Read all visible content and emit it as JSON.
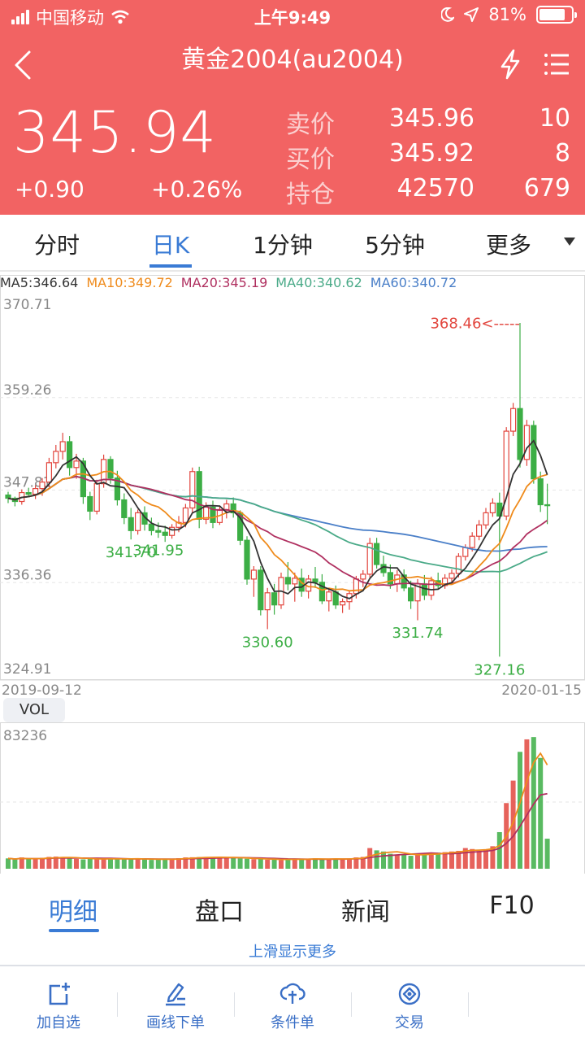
{
  "status_bar": {
    "carrier": "中国移动",
    "time": "上午9:49",
    "battery": "81%",
    "battery_level": 0.81
  },
  "nav": {
    "title": "黄金2004(au2004)",
    "icons": [
      "back-icon",
      "flash-icon",
      "menu-icon"
    ]
  },
  "quote": {
    "last_price": "345.94",
    "change": "+0.90",
    "change_pct": "+0.26%",
    "ask": {
      "label": "卖价",
      "price": "345.96",
      "size": "10"
    },
    "bid": {
      "label": "买价",
      "price": "345.92",
      "size": "8"
    },
    "open_interest": {
      "label": "持仓",
      "value": "42570",
      "change": "679"
    }
  },
  "period_tabs": {
    "items": [
      "分时",
      "日K",
      "1分钟",
      "5分钟",
      "更多"
    ],
    "active": "日K"
  },
  "ma_legend": {
    "ma5": "MA5:346.64",
    "ma10": "MA10:349.72",
    "ma20": "MA20:345.19",
    "ma40": "MA40:340.62",
    "ma60": "MA60:340.72"
  },
  "colors": {
    "up": "#e2463e",
    "down": "#3cae45",
    "accent": "#3a7bd5",
    "header": "#f26363",
    "ma5": "#333333",
    "ma10": "#ef8b1c",
    "ma20": "#b03060",
    "ma40": "#4aaa88",
    "ma60": "#4a7fc8"
  },
  "chart_data": [
    {
      "type": "candlestick",
      "x_start": "2019-09-12",
      "x_end": "2020-01-15",
      "y_ticks": [
        "370.71",
        "359.26",
        "347.81",
        "336.36",
        "324.91"
      ],
      "ylim": [
        324.91,
        370.71
      ],
      "annotations": [
        {
          "label": "368.46<-----",
          "value": 368.46
        },
        {
          "label": "341.70",
          "value": 341.7
        },
        {
          "label": "341.95",
          "value": 341.95
        },
        {
          "label": "330.60",
          "value": 330.6
        },
        {
          "label": "331.74",
          "value": 331.74
        },
        {
          "label": "327.16",
          "value": 327.16
        }
      ],
      "candles": [
        [
          347.2,
          347.6,
          346.2,
          346.8
        ],
        [
          346.8,
          347.0,
          345.8,
          346.4
        ],
        [
          346.4,
          347.9,
          346.0,
          347.5
        ],
        [
          347.5,
          348.1,
          346.9,
          347.3
        ],
        [
          347.3,
          348.4,
          346.7,
          348.0
        ],
        [
          348.0,
          349.3,
          347.1,
          348.8
        ],
        [
          348.8,
          351.8,
          348.2,
          351.2
        ],
        [
          351.2,
          353.4,
          350.5,
          352.6
        ],
        [
          352.6,
          354.9,
          351.6,
          353.8
        ],
        [
          353.8,
          354.5,
          349.6,
          350.6
        ],
        [
          350.6,
          352.3,
          349.2,
          351.4
        ],
        [
          351.4,
          351.8,
          346.1,
          347.0
        ],
        [
          347.0,
          347.6,
          344.1,
          345.2
        ],
        [
          345.2,
          349.1,
          344.8,
          348.6
        ],
        [
          348.6,
          352.2,
          348.1,
          351.6
        ],
        [
          351.6,
          352.0,
          348.6,
          349.3
        ],
        [
          349.3,
          350.2,
          345.9,
          346.6
        ],
        [
          346.6,
          347.4,
          343.6,
          344.4
        ],
        [
          344.4,
          345.6,
          341.7,
          342.8
        ],
        [
          342.8,
          345.4,
          342.3,
          345.0
        ],
        [
          345.0,
          345.8,
          342.8,
          343.6
        ],
        [
          343.6,
          344.4,
          342.2,
          342.8
        ],
        [
          342.8,
          343.8,
          341.9,
          342.6
        ],
        [
          342.6,
          343.4,
          341.4,
          342.2
        ],
        [
          342.2,
          343.6,
          341.8,
          343.2
        ],
        [
          343.2,
          344.6,
          342.6,
          343.8
        ],
        [
          343.8,
          346.1,
          343.2,
          345.6
        ],
        [
          345.6,
          350.6,
          345.0,
          350.1
        ],
        [
          350.1,
          350.7,
          343.1,
          344.2
        ],
        [
          344.2,
          346.3,
          343.6,
          345.7
        ],
        [
          345.7,
          346.5,
          343.1,
          343.8
        ],
        [
          343.8,
          345.9,
          343.5,
          345.4
        ],
        [
          345.4,
          346.6,
          344.3,
          346.1
        ],
        [
          346.1,
          346.9,
          344.4,
          345.0
        ],
        [
          345.0,
          345.3,
          341.0,
          341.6
        ],
        [
          341.6,
          342.1,
          336.1,
          336.8
        ],
        [
          336.8,
          338.4,
          334.6,
          337.9
        ],
        [
          337.9,
          338.4,
          332.3,
          333.0
        ],
        [
          333.0,
          335.7,
          330.6,
          335.1
        ],
        [
          335.1,
          336.2,
          332.4,
          333.6
        ],
        [
          333.6,
          337.6,
          333.1,
          337.0
        ],
        [
          337.0,
          338.9,
          335.4,
          336.2
        ],
        [
          336.2,
          337.6,
          334.0,
          336.9
        ],
        [
          336.9,
          338.1,
          334.6,
          335.3
        ],
        [
          335.3,
          337.3,
          334.4,
          336.8
        ],
        [
          336.8,
          338.3,
          335.7,
          336.4
        ],
        [
          336.4,
          337.4,
          333.7,
          334.1
        ],
        [
          334.1,
          335.6,
          332.8,
          335.2
        ],
        [
          335.2,
          336.0,
          333.1,
          333.6
        ],
        [
          333.6,
          334.4,
          332.6,
          334.0
        ],
        [
          334.0,
          335.4,
          333.0,
          335.0
        ],
        [
          335.0,
          337.2,
          334.4,
          336.8
        ],
        [
          336.8,
          337.9,
          335.8,
          337.4
        ],
        [
          337.4,
          341.9,
          337.0,
          341.2
        ],
        [
          341.2,
          341.9,
          338.1,
          338.6
        ],
        [
          338.6,
          339.7,
          337.1,
          337.6
        ],
        [
          337.6,
          338.6,
          335.6,
          336.2
        ],
        [
          336.2,
          337.9,
          335.2,
          337.3
        ],
        [
          337.3,
          338.0,
          335.3,
          335.7
        ],
        [
          335.7,
          336.6,
          333.1,
          334.1
        ],
        [
          334.1,
          336.8,
          331.7,
          336.2
        ],
        [
          336.2,
          337.3,
          334.2,
          334.8
        ],
        [
          334.8,
          337.1,
          334.2,
          336.6
        ],
        [
          336.6,
          337.6,
          335.6,
          336.0
        ],
        [
          336.0,
          337.4,
          335.6,
          336.9
        ],
        [
          336.9,
          338.0,
          336.2,
          337.5
        ],
        [
          337.5,
          340.0,
          337.0,
          339.6
        ],
        [
          339.6,
          341.1,
          339.1,
          340.7
        ],
        [
          340.7,
          342.6,
          340.2,
          342.1
        ],
        [
          342.1,
          344.1,
          341.6,
          343.5
        ],
        [
          343.5,
          345.6,
          343.0,
          345.0
        ],
        [
          345.0,
          346.8,
          344.5,
          346.2
        ],
        [
          346.2,
          347.5,
          327.2,
          344.6
        ],
        [
          344.6,
          355.6,
          344.1,
          355.1
        ],
        [
          355.1,
          358.6,
          354.5,
          357.9
        ],
        [
          357.9,
          368.5,
          350.6,
          351.6
        ],
        [
          351.6,
          356.5,
          350.8,
          355.8
        ],
        [
          355.8,
          356.4,
          348.6,
          349.2
        ],
        [
          349.2,
          350.1,
          345.1,
          346.0
        ],
        [
          346.0,
          348.6,
          343.6,
          345.9
        ]
      ]
    },
    {
      "type": "bar",
      "label": "VOL",
      "y_ticks": [
        "83236"
      ],
      "ymax": 83236,
      "volumes": [
        6300,
        5600,
        6900,
        5800,
        6100,
        6600,
        7200,
        7400,
        6900,
        6300,
        6000,
        5700,
        6200,
        5800,
        6000,
        6300,
        5700,
        6100,
        5900,
        6300,
        5800,
        5400,
        5600,
        5900,
        6100,
        6400,
        6900,
        7000,
        7100,
        6700,
        6900,
        7300,
        6800,
        6500,
        6300,
        6100,
        5800,
        6000,
        5500,
        5800,
        5200,
        5900,
        6200,
        5600,
        6000,
        6300,
        5700,
        5900,
        6100,
        5800,
        6200,
        6900,
        7200,
        12600,
        11200,
        10500,
        9100,
        8400,
        9000,
        7900,
        8200,
        9300,
        9600,
        9800,
        10100,
        10500,
        10900,
        12600,
        12000,
        10800,
        11500,
        13700,
        22300,
        40000,
        53700,
        71200,
        78800,
        80200,
        67500,
        18300
      ]
    }
  ],
  "vol_chip": "VOL",
  "info_tabs": {
    "items": [
      "明细",
      "盘口",
      "新闻",
      "F10"
    ],
    "active": "明细"
  },
  "more_hint": "上滑显示更多",
  "actions": [
    {
      "label": "加自选",
      "icon": "add-watchlist-icon"
    },
    {
      "label": "画线下单",
      "icon": "draw-line-icon"
    },
    {
      "label": "条件单",
      "icon": "conditional-order-icon"
    },
    {
      "label": "交易",
      "icon": "trade-icon"
    }
  ]
}
